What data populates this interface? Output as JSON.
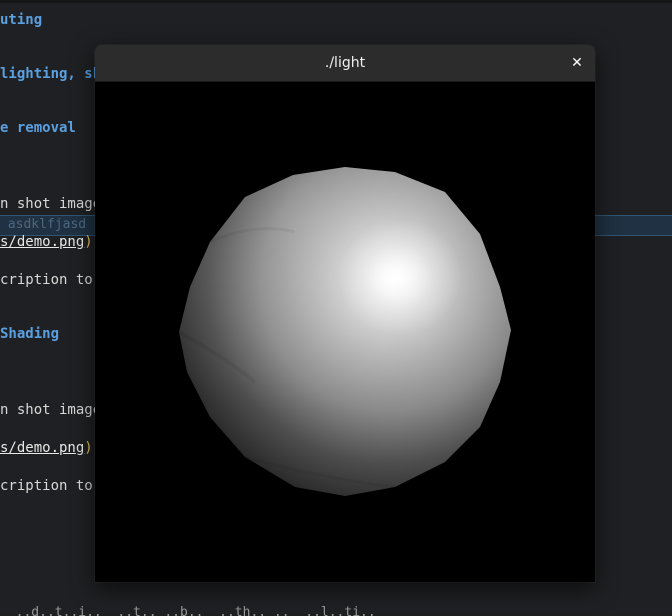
{
  "editor": {
    "lines": [
      {
        "text": "uting",
        "style": "heading"
      },
      {
        "text": "lighting, sh",
        "style": "heading"
      },
      {
        "text": "e removal",
        "style": "heading"
      },
      {
        "text": "n shot image",
        "style": "plain"
      },
      {
        "text": "s/demo.png",
        "style": "link"
      },
      {
        "text": "cription to",
        "style": "plain"
      },
      {
        "text": "Shading",
        "style": "heading"
      },
      {
        "text": "n shot image",
        "style": "plain"
      },
      {
        "text": "s/demo.png",
        "style": "link"
      },
      {
        "text": "cription to",
        "style": "plain"
      }
    ],
    "link_close_paren": ")",
    "highlight_ghost_text": " asdklfjasd",
    "bottom_text": "  ..d..t..i..  ..t.. ..b..  ..th.. ..  ..l..ti.."
  },
  "window": {
    "title": "./light",
    "close_glyph": "✕"
  },
  "colors": {
    "heading": "#5aa0e0",
    "paren": "#e0c060",
    "highlight": "#1f3142",
    "background": "#1f2023"
  }
}
